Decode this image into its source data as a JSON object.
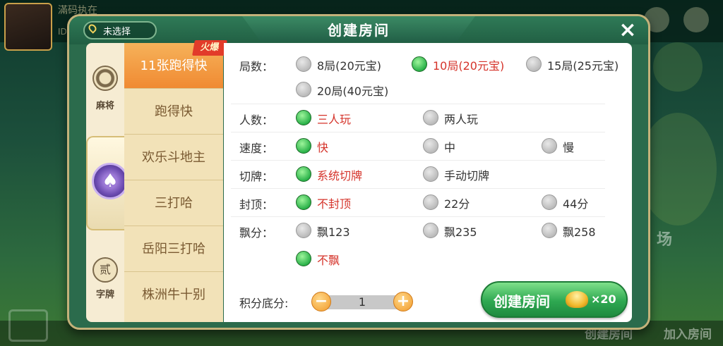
{
  "background": {
    "player_name": "滿码执在",
    "player_id": "ID：  ICO",
    "bottom_buttons": [
      "创建房间",
      "加入房间"
    ],
    "side_text": "场"
  },
  "dialog": {
    "title": "创建房间",
    "location": "未选择",
    "close_symbol": "×"
  },
  "categories": [
    {
      "label": "麻将",
      "icon": "mahjong-icon"
    },
    {
      "label": "",
      "icon": "spade-icon",
      "selected": true
    },
    {
      "label": "字牌",
      "icon": "zipai-icon",
      "glyph": "贰"
    }
  ],
  "games": [
    {
      "label": "11张跑得快",
      "selected": true,
      "badge": "火爆"
    },
    {
      "label": "跑得快"
    },
    {
      "label": "欢乐斗地主"
    },
    {
      "label": "三打哈"
    },
    {
      "label": "岳阳三打哈"
    },
    {
      "label": "株洲牛十别"
    }
  ],
  "options": {
    "rounds": {
      "label": "局数：",
      "choices": [
        "8局(20元宝)",
        "10局(20元宝)",
        "15局(25元宝)",
        "20局(40元宝)"
      ],
      "selected": "10局(20元宝)"
    },
    "players": {
      "label": "人数：",
      "choices": [
        "三人玩",
        "两人玩"
      ],
      "selected": "三人玩"
    },
    "speed": {
      "label": "速度：",
      "choices": [
        "快",
        "中",
        "慢"
      ],
      "selected": "快"
    },
    "cut": {
      "label": "切牌：",
      "choices": [
        "系统切牌",
        "手动切牌"
      ],
      "selected": "系统切牌"
    },
    "cap": {
      "label": "封顶：",
      "choices": [
        "不封顶",
        "22分",
        "44分"
      ],
      "selected": "不封顶"
    },
    "float": {
      "label": "飘分：",
      "choices": [
        "飘123",
        "飘235",
        "飘258",
        "不飘"
      ],
      "selected": "不飘"
    }
  },
  "score_base": {
    "label": "积分底分:",
    "value": "1",
    "minus": "−",
    "plus": "+"
  },
  "create_button": {
    "label": "创建房间",
    "cost": "×20",
    "icon": "gold-ingot-icon"
  },
  "colors": {
    "selected_text": "#d5332a",
    "accent_green": "#2ea851",
    "tab_active": "#f08a32"
  }
}
